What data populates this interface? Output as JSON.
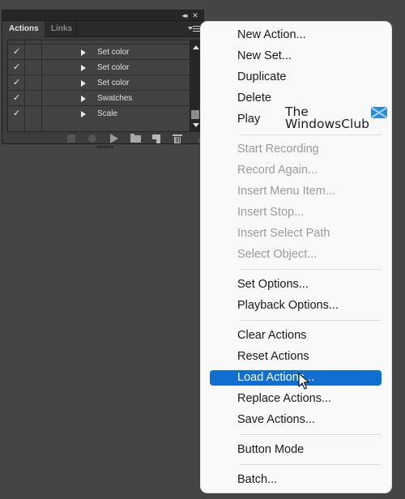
{
  "panel": {
    "titlebar": {
      "collapse_icon": "double-chevron-left-icon",
      "collapse_glyph": "◂◂",
      "close_icon": "close-icon",
      "close_glyph": "✕"
    },
    "tabs": [
      {
        "label": "Actions",
        "active": true
      },
      {
        "label": "Links",
        "active": false
      }
    ],
    "menu_icon": "panel-flyout-menu-icon",
    "rows": [
      {
        "checked": true,
        "check_glyph": "✓",
        "label": "Set color"
      },
      {
        "checked": true,
        "check_glyph": "✓",
        "label": "Set color"
      },
      {
        "checked": true,
        "check_glyph": "✓",
        "label": "Set color"
      },
      {
        "checked": true,
        "check_glyph": "✓",
        "label": "Swatches"
      },
      {
        "checked": true,
        "check_glyph": "✓",
        "label": "Scale"
      }
    ],
    "toolbar": [
      {
        "name": "stop-playing-recording",
        "icon": "stop-icon",
        "enabled": false
      },
      {
        "name": "begin-recording",
        "icon": "record-icon",
        "enabled": false
      },
      {
        "name": "play-selection",
        "icon": "play-icon",
        "enabled": true
      },
      {
        "name": "create-new-set",
        "icon": "folder-icon",
        "enabled": true
      },
      {
        "name": "create-new-action",
        "icon": "new-item-icon",
        "enabled": true
      },
      {
        "name": "delete",
        "icon": "trash-icon",
        "enabled": true
      }
    ]
  },
  "menu": {
    "items": [
      {
        "label": "New Action...",
        "enabled": true
      },
      {
        "label": "New Set...",
        "enabled": true
      },
      {
        "label": "Duplicate",
        "enabled": true
      },
      {
        "label": "Delete",
        "enabled": true
      },
      {
        "label": "Play",
        "enabled": true
      },
      {
        "label": "Start Recording",
        "enabled": false
      },
      {
        "label": "Record Again...",
        "enabled": false
      },
      {
        "label": "Insert Menu Item...",
        "enabled": false
      },
      {
        "label": "Insert Stop...",
        "enabled": false
      },
      {
        "label": "Insert Select Path",
        "enabled": false
      },
      {
        "label": "Select Object...",
        "enabled": false
      },
      {
        "label": "Set Options...",
        "enabled": true
      },
      {
        "label": "Playback Options...",
        "enabled": true
      },
      {
        "label": "Clear Actions",
        "enabled": true
      },
      {
        "label": "Reset Actions",
        "enabled": true
      },
      {
        "label": "Load Actions...",
        "enabled": true,
        "selected": true
      },
      {
        "label": "Replace Actions...",
        "enabled": true
      },
      {
        "label": "Save Actions...",
        "enabled": true
      },
      {
        "label": "Button Mode",
        "enabled": true
      },
      {
        "label": "Batch...",
        "enabled": true
      }
    ],
    "highlight_color": "#0f6fd3",
    "disabled_color": "#9b9b9b"
  },
  "watermark": {
    "line1": "The",
    "line2": "WindowsClub",
    "logo_color": "#2b8ed4"
  }
}
